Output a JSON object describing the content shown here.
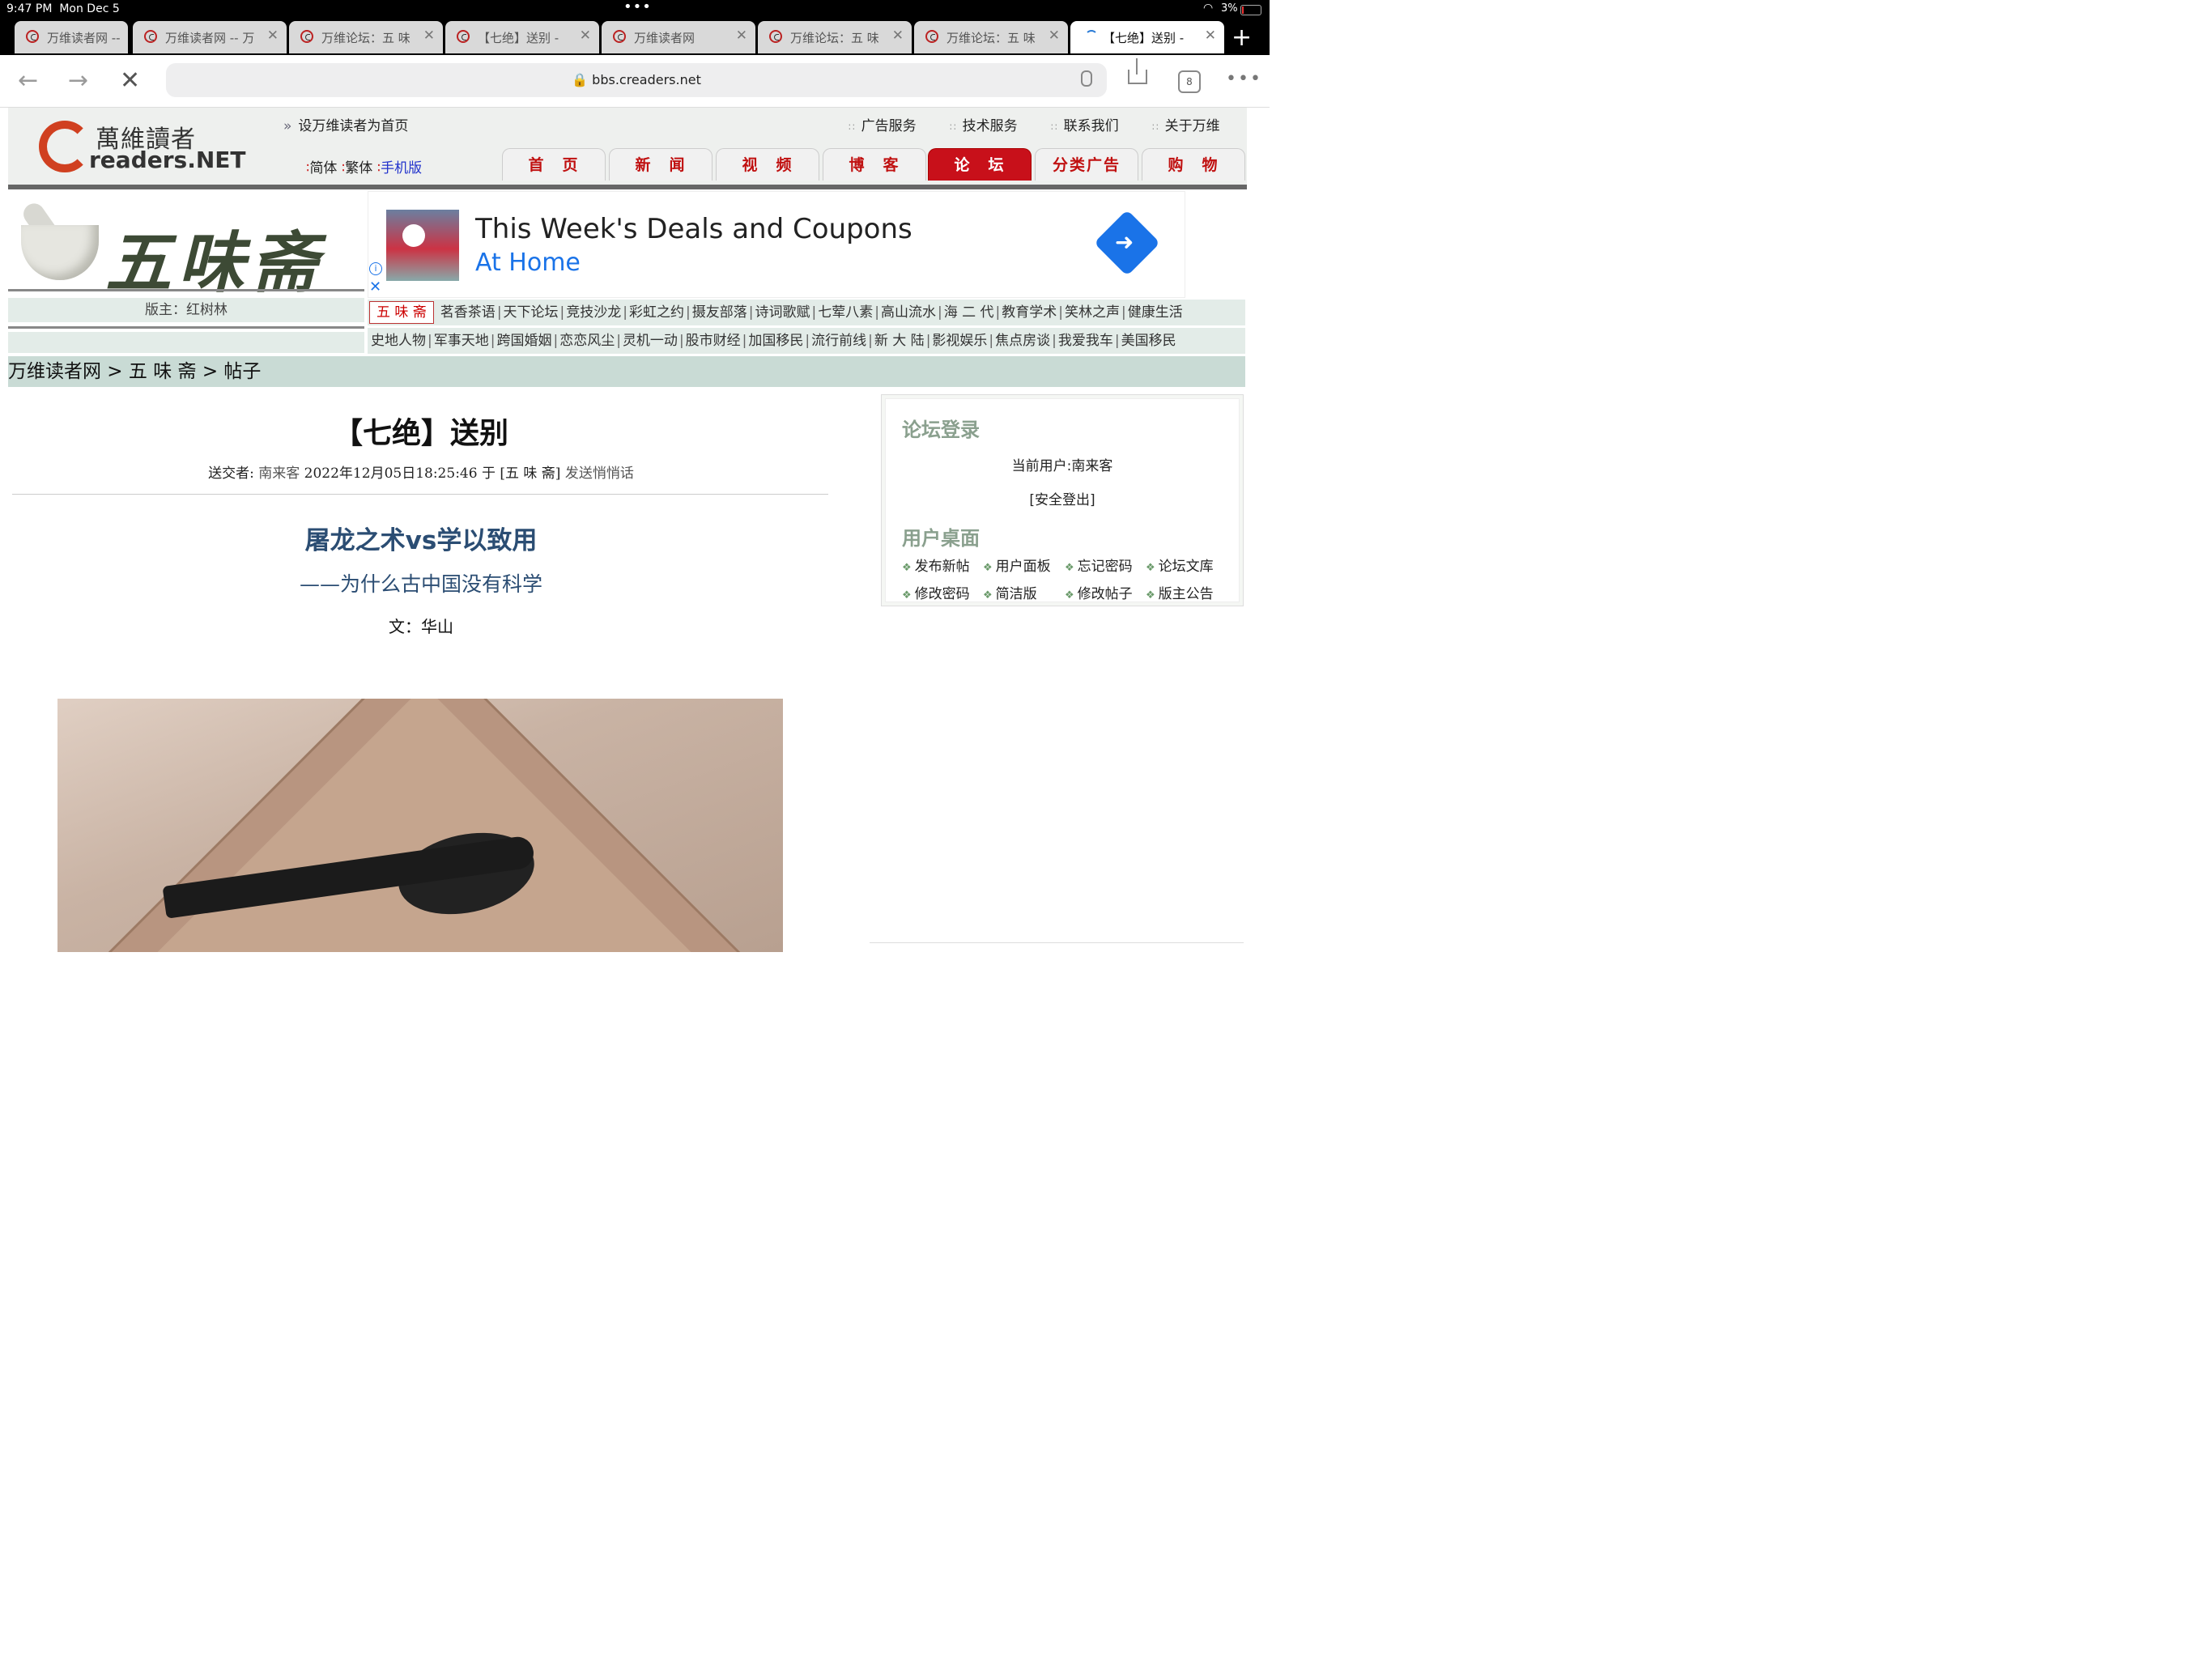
{
  "status_bar": {
    "time": "9:47 PM",
    "date": "Mon Dec 5",
    "battery": "3%"
  },
  "browser": {
    "tabs": [
      {
        "label": "万维读者网 --"
      },
      {
        "label": "万维读者网 -- 万"
      },
      {
        "label": "万维论坛：五 味"
      },
      {
        "label": "【七绝】送别 -"
      },
      {
        "label": "万维读者网"
      },
      {
        "label": "万维论坛：五 味"
      },
      {
        "label": "万维论坛：五 味"
      },
      {
        "label": "【七绝】送别 -"
      }
    ],
    "url": "bbs.creaders.net",
    "tab_count": "8"
  },
  "site": {
    "logo_cn": "萬維讀者",
    "logo_en": "readers.NET",
    "set_home": "设万维读者为首页",
    "top_links": [
      "广告服务",
      "技术服务",
      "联系我们",
      "关于万维"
    ],
    "lang": {
      "simplified": "简体",
      "traditional": "繁体",
      "mobile": "手机版"
    },
    "nav": [
      "首　页",
      "新　闻",
      "视　频",
      "博　客",
      "论　坛",
      "分类广告",
      "购　物"
    ]
  },
  "forum": {
    "name": "五味斋",
    "moderator": "版主：红树林",
    "current": "五 味 斋",
    "subnav1": [
      "茗香茶语",
      "天下论坛",
      "竞技沙龙",
      "彩虹之约",
      "摄友部落",
      "诗词歌赋",
      "七荤八素",
      "高山流水",
      "海 二 代",
      "教育学术",
      "笑林之声",
      "健康生活"
    ],
    "subnav2": [
      "史地人物",
      "军事天地",
      "跨国婚姻",
      "恋恋风尘",
      "灵机一动",
      "股市财经",
      "加国移民",
      "流行前线",
      "新 大 陆",
      "影视娱乐",
      "焦点房谈",
      "我爱我车",
      "美国移民"
    ]
  },
  "ad": {
    "title": "This Week's Deals and Coupons",
    "subtitle": "At Home"
  },
  "breadcrumb": "万维读者网 > 五 味 斋 > 帖子",
  "post": {
    "title": "【七绝】送别",
    "meta_label": "送交者:",
    "author": "南来客",
    "datetime": "2022年12月05日18:25:46",
    "forum_ref": "于 [五 味 斋]",
    "whisper": "发送悄悄话",
    "article_title": "屠龙之术vs学以致用",
    "article_subtitle": "——为什么古中国没有科学",
    "article_author": "文：华山"
  },
  "sidebar": {
    "login_heading": "论坛登录",
    "current_user": "当前用户:南来客",
    "logout": "[安全登出]",
    "desk_heading": "用户桌面",
    "desk_items": [
      "发布新帖",
      "用户面板",
      "忘记密码",
      "论坛文库",
      "修改密码",
      "简洁版",
      "修改帖子",
      "版主公告"
    ]
  }
}
